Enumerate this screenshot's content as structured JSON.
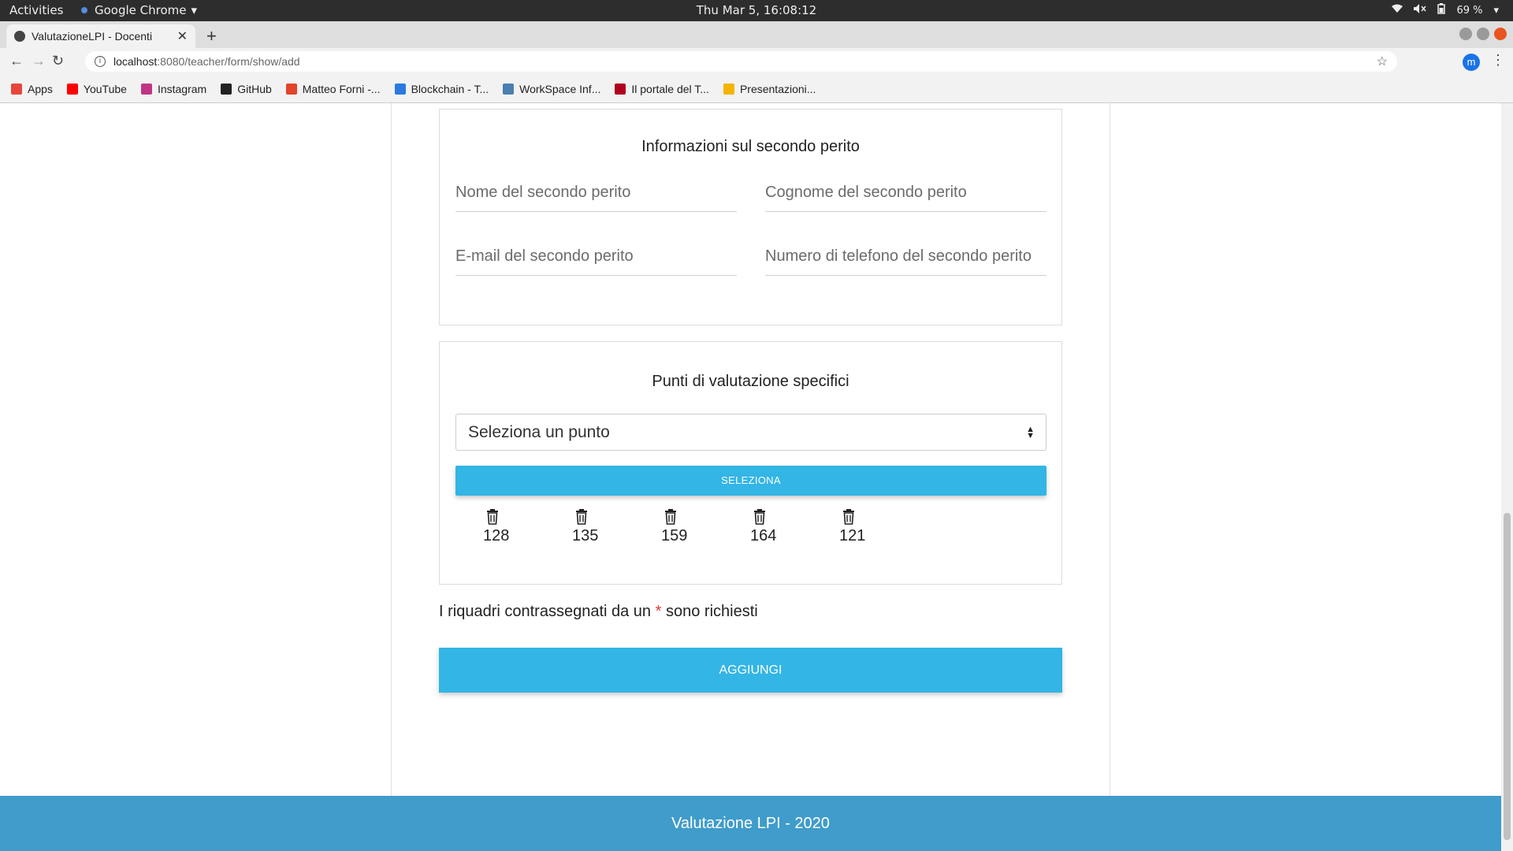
{
  "os": {
    "activities": "Activities",
    "app_name": "Google Chrome",
    "clock": "Thu Mar  5, 16:08:12",
    "battery": "69 %"
  },
  "browser": {
    "tab_title": "ValutazioneLPI - Docenti",
    "url_host": "localhost",
    "url_path": ":8080/teacher/form/show/add",
    "avatar_letter": "m",
    "bookmarks": [
      {
        "label": "Apps",
        "color": "#e8453c"
      },
      {
        "label": "YouTube",
        "color": "#ff0000"
      },
      {
        "label": "Instagram",
        "color": "#c13584"
      },
      {
        "label": "GitHub",
        "color": "#222222"
      },
      {
        "label": "Matteo Forni -...",
        "color": "#e24329"
      },
      {
        "label": "Blockchain - T...",
        "color": "#2a7ae2"
      },
      {
        "label": "WorkSpace Inf...",
        "color": "#4a7fb0"
      },
      {
        "label": "Il portale del T...",
        "color": "#b00020"
      },
      {
        "label": "Presentazioni...",
        "color": "#f4b400"
      }
    ]
  },
  "form": {
    "section_expert": {
      "title": "Informazioni sul secondo perito",
      "first_name_placeholder": "Nome del secondo perito",
      "last_name_placeholder": "Cognome del secondo perito",
      "email_placeholder": "E-mail del secondo perito",
      "phone_placeholder": "Numero di telefono del secondo perito"
    },
    "section_points": {
      "title": "Punti di valutazione specifici",
      "select_value": "Seleziona un punto",
      "select_button": "SELEZIONA",
      "selected_points": [
        "128",
        "135",
        "159",
        "164",
        "121"
      ]
    },
    "required_note_before": "I riquadri contrassegnati da un",
    "required_star": "*",
    "required_note_after": "sono richiesti",
    "submit_label": "AGGIUNGI"
  },
  "footer": {
    "text": "Valutazione LPI - 2020"
  },
  "colors": {
    "accent": "#33b5e5",
    "footer_bg": "#3f9ccb",
    "required": "#e53935"
  }
}
